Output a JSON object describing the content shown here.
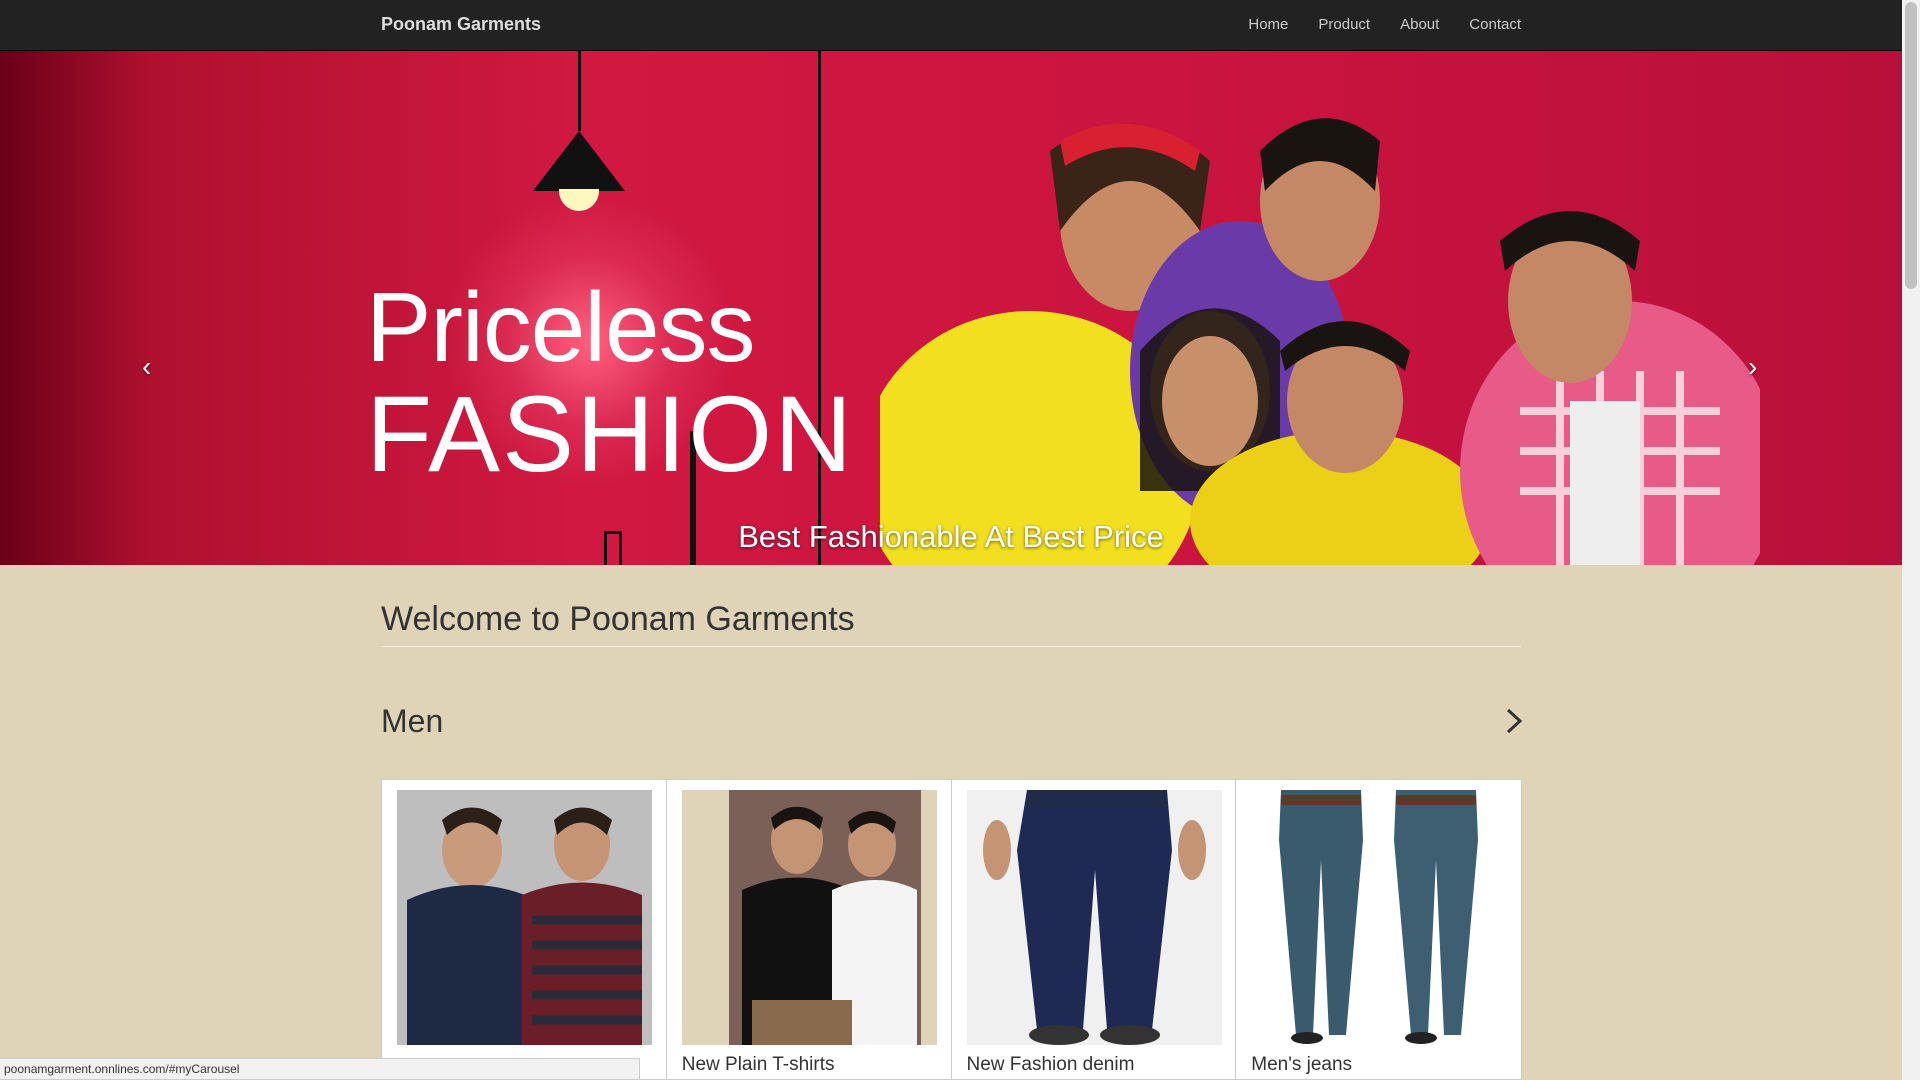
{
  "navbar": {
    "brand": "Poonam Garments",
    "links": [
      "Home",
      "Product",
      "About",
      "Contact"
    ]
  },
  "carousel": {
    "hero_line1": "Priceless",
    "hero_line2": "FASHION",
    "caption": "Best Fashionable At Best Price",
    "indicator_count": 5,
    "active_indicator": 2,
    "prev_glyph": "‹",
    "next_glyph": "›"
  },
  "main": {
    "welcome": "Welcome to Poonam Garments",
    "section_title": "Men",
    "products": [
      {
        "title": "",
        "image": "polo-tshirts-image"
      },
      {
        "title": "New Plain T-shirts",
        "image": "plain-tshirts-image"
      },
      {
        "title": "New Fashion denim",
        "image": "denim-jeans-image"
      },
      {
        "title": "Men's jeans",
        "image": "mens-jeans-image"
      }
    ]
  },
  "status_bar": {
    "url": "poonamgarment.onnlines.com/#myCarousel"
  },
  "colors": {
    "navbar_bg": "#222222",
    "page_bg": "#e0d4b8",
    "carousel_red": "#d01840"
  }
}
